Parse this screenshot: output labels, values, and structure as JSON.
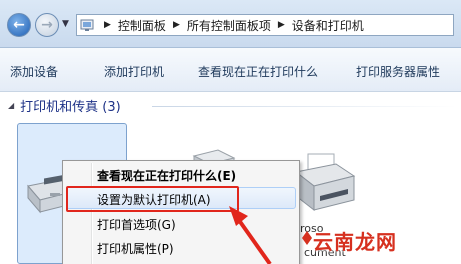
{
  "breadcrumb": [
    "控制面板",
    "所有控制面板项",
    "设备和打印机"
  ],
  "toolbar": {
    "items": [
      "添加设备",
      "添加打印机",
      "查看现在正在打印什么",
      "打印服务器属性"
    ]
  },
  "section": {
    "title": "打印机和传真 (3)"
  },
  "devices": {
    "right_label_line1": "roso",
    "right_label_line2": "cument"
  },
  "context_menu": {
    "items": [
      {
        "label": "查看现在正在打印什么(E)",
        "bold": true
      },
      {
        "label": "设置为默认打印机(A)",
        "highlighted": true
      },
      {
        "label": "打印首选项(G)"
      },
      {
        "label": "打印机属性(P)"
      }
    ]
  },
  "annotation": {
    "highlight_color": "#e1261c"
  },
  "watermark": {
    "text": "云南龙网"
  },
  "icons": {
    "back": "back-arrow-icon",
    "forward": "forward-arrow-icon",
    "location": "control-panel-icon",
    "printer": "printer-icon",
    "fax": "fax-printer-icon"
  }
}
